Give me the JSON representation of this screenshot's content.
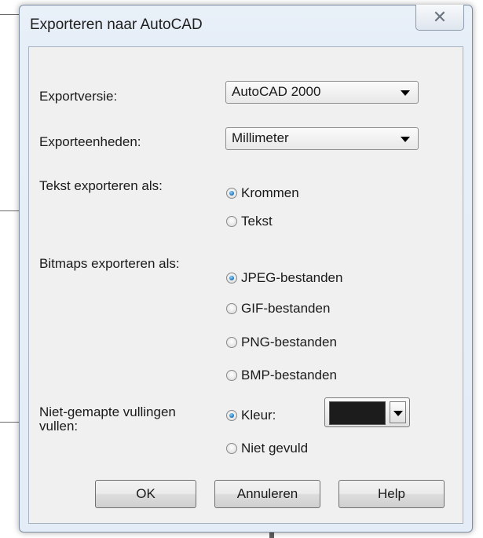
{
  "dialog": {
    "title": "Exporteren naar AutoCAD",
    "close_icon": "close-icon"
  },
  "export_version": {
    "label": "Exportversie:",
    "value": "AutoCAD 2000"
  },
  "export_units": {
    "label": "Exporteenheden:",
    "value": "Millimeter"
  },
  "text_export": {
    "label": "Tekst exporteren als:",
    "options": [
      "Krommen",
      "Tekst"
    ],
    "selected": "Krommen"
  },
  "bitmap_export": {
    "label": "Bitmaps exporteren als:",
    "options": [
      "JPEG-bestanden",
      "GIF-bestanden",
      "PNG-bestanden",
      "BMP-bestanden"
    ],
    "selected": "JPEG-bestanden"
  },
  "unmapped_fills": {
    "label_line1": "Niet-gemapte vullingen",
    "label_line2": "vullen:",
    "options": [
      "Kleur:",
      "Niet gevuld"
    ],
    "selected": "Kleur:",
    "color": "#1c1c1c"
  },
  "buttons": {
    "ok": "OK",
    "cancel": "Annuleren",
    "help": "Help"
  }
}
